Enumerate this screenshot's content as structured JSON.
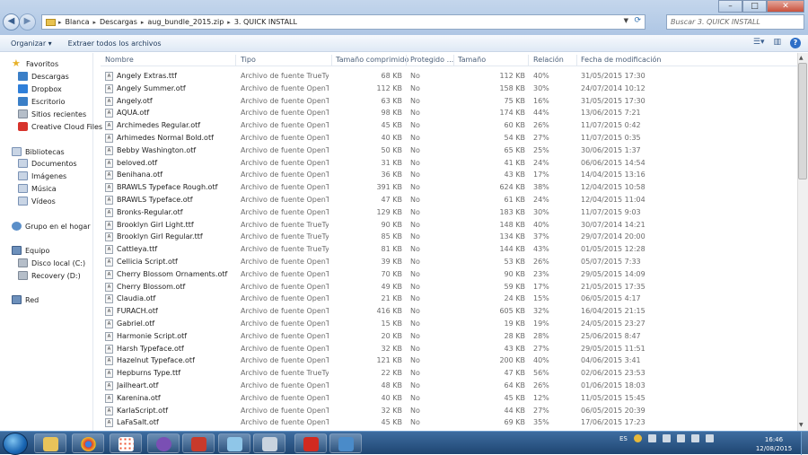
{
  "window": {
    "breadcrumbs": [
      "Blanca",
      "Descargas",
      "aug_bundle_2015.zip",
      "3. QUICK INSTALL"
    ],
    "search_placeholder": "Buscar 3. QUICK INSTALL",
    "minimize": "–",
    "maximize": "□",
    "close": "✕"
  },
  "toolbar": {
    "organize_label": "Organizar ▾",
    "extract_label": "Extraer todos los archivos",
    "help_label": "?"
  },
  "sidebar": {
    "favorites": {
      "label": "Favoritos",
      "items": [
        "Descargas",
        "Dropbox",
        "Escritorio",
        "Sitios recientes",
        "Creative Cloud Files"
      ]
    },
    "libraries": {
      "label": "Bibliotecas",
      "items": [
        "Documentos",
        "Imágenes",
        "Música",
        "Vídeos"
      ]
    },
    "homegroup": {
      "label": "Grupo en el hogar"
    },
    "computer": {
      "label": "Equipo",
      "items": [
        "Disco local (C:)",
        "Recovery (D:)"
      ]
    },
    "network": {
      "label": "Red"
    }
  },
  "columns": [
    "Nombre",
    "Tipo",
    "Tamaño comprimido",
    "Protegido ...",
    "Tamaño",
    "Relación",
    "Fecha de modificación"
  ],
  "files": [
    {
      "name": "Angely Extras.ttf",
      "type": "Archivo de fuente TrueTy...",
      "comp": "68 KB",
      "prot": "No",
      "size": "112 KB",
      "ratio": "40%",
      "date": "31/05/2015 17:30"
    },
    {
      "name": "Angely Summer.otf",
      "type": "Archivo de fuente OpenT...",
      "comp": "112 KB",
      "prot": "No",
      "size": "158 KB",
      "ratio": "30%",
      "date": "24/07/2014 10:12"
    },
    {
      "name": "Angely.otf",
      "type": "Archivo de fuente OpenT...",
      "comp": "63 KB",
      "prot": "No",
      "size": "75 KB",
      "ratio": "16%",
      "date": "31/05/2015 17:30"
    },
    {
      "name": "AQUA.otf",
      "type": "Archivo de fuente OpenT...",
      "comp": "98 KB",
      "prot": "No",
      "size": "174 KB",
      "ratio": "44%",
      "date": "13/06/2015 7:21"
    },
    {
      "name": "Archimedes Regular.otf",
      "type": "Archivo de fuente OpenT...",
      "comp": "45 KB",
      "prot": "No",
      "size": "60 KB",
      "ratio": "26%",
      "date": "11/07/2015 0:42"
    },
    {
      "name": "Arhimedes Normal Bold.otf",
      "type": "Archivo de fuente OpenT...",
      "comp": "40 KB",
      "prot": "No",
      "size": "54 KB",
      "ratio": "27%",
      "date": "11/07/2015 0:35"
    },
    {
      "name": "Bebby Washington.otf",
      "type": "Archivo de fuente OpenT...",
      "comp": "50 KB",
      "prot": "No",
      "size": "65 KB",
      "ratio": "25%",
      "date": "30/06/2015 1:37"
    },
    {
      "name": "beloved.otf",
      "type": "Archivo de fuente OpenT...",
      "comp": "31 KB",
      "prot": "No",
      "size": "41 KB",
      "ratio": "24%",
      "date": "06/06/2015 14:54"
    },
    {
      "name": "Benihana.otf",
      "type": "Archivo de fuente OpenT...",
      "comp": "36 KB",
      "prot": "No",
      "size": "43 KB",
      "ratio": "17%",
      "date": "14/04/2015 13:16"
    },
    {
      "name": "BRAWLS Typeface Rough.otf",
      "type": "Archivo de fuente OpenT...",
      "comp": "391 KB",
      "prot": "No",
      "size": "624 KB",
      "ratio": "38%",
      "date": "12/04/2015 10:58"
    },
    {
      "name": "BRAWLS Typeface.otf",
      "type": "Archivo de fuente OpenT...",
      "comp": "47 KB",
      "prot": "No",
      "size": "61 KB",
      "ratio": "24%",
      "date": "12/04/2015 11:04"
    },
    {
      "name": "Bronks-Regular.otf",
      "type": "Archivo de fuente OpenT...",
      "comp": "129 KB",
      "prot": "No",
      "size": "183 KB",
      "ratio": "30%",
      "date": "11/07/2015 9:03"
    },
    {
      "name": "Brooklyn Girl Light.ttf",
      "type": "Archivo de fuente TrueTy...",
      "comp": "90 KB",
      "prot": "No",
      "size": "148 KB",
      "ratio": "40%",
      "date": "30/07/2014 14:21"
    },
    {
      "name": "Brooklyn Girl Regular.ttf",
      "type": "Archivo de fuente TrueTy...",
      "comp": "85 KB",
      "prot": "No",
      "size": "134 KB",
      "ratio": "37%",
      "date": "29/07/2014 20:00"
    },
    {
      "name": "Cattleya.ttf",
      "type": "Archivo de fuente TrueTy...",
      "comp": "81 KB",
      "prot": "No",
      "size": "144 KB",
      "ratio": "43%",
      "date": "01/05/2015 12:28"
    },
    {
      "name": "Cellicia Script.otf",
      "type": "Archivo de fuente OpenT...",
      "comp": "39 KB",
      "prot": "No",
      "size": "53 KB",
      "ratio": "26%",
      "date": "05/07/2015 7:33"
    },
    {
      "name": "Cherry Blossom Ornaments.otf",
      "type": "Archivo de fuente OpenT...",
      "comp": "70 KB",
      "prot": "No",
      "size": "90 KB",
      "ratio": "23%",
      "date": "29/05/2015 14:09"
    },
    {
      "name": "Cherry Blossom.otf",
      "type": "Archivo de fuente OpenT...",
      "comp": "49 KB",
      "prot": "No",
      "size": "59 KB",
      "ratio": "17%",
      "date": "21/05/2015 17:35"
    },
    {
      "name": "Claudia.otf",
      "type": "Archivo de fuente OpenT...",
      "comp": "21 KB",
      "prot": "No",
      "size": "24 KB",
      "ratio": "15%",
      "date": "06/05/2015 4:17"
    },
    {
      "name": "FURACH.otf",
      "type": "Archivo de fuente OpenT...",
      "comp": "416 KB",
      "prot": "No",
      "size": "605 KB",
      "ratio": "32%",
      "date": "16/04/2015 21:15"
    },
    {
      "name": "Gabriel.otf",
      "type": "Archivo de fuente OpenT...",
      "comp": "15 KB",
      "prot": "No",
      "size": "19 KB",
      "ratio": "19%",
      "date": "24/05/2015 23:27"
    },
    {
      "name": "Harmonie Script.otf",
      "type": "Archivo de fuente OpenT...",
      "comp": "20 KB",
      "prot": "No",
      "size": "28 KB",
      "ratio": "28%",
      "date": "25/06/2015 8:47"
    },
    {
      "name": "Harsh Typeface.otf",
      "type": "Archivo de fuente OpenT...",
      "comp": "32 KB",
      "prot": "No",
      "size": "43 KB",
      "ratio": "27%",
      "date": "29/05/2015 11:51"
    },
    {
      "name": "Hazelnut Typeface.otf",
      "type": "Archivo de fuente OpenT...",
      "comp": "121 KB",
      "prot": "No",
      "size": "200 KB",
      "ratio": "40%",
      "date": "04/06/2015 3:41"
    },
    {
      "name": "Hepburns Type.ttf",
      "type": "Archivo de fuente TrueTy...",
      "comp": "22 KB",
      "prot": "No",
      "size": "47 KB",
      "ratio": "56%",
      "date": "02/06/2015 23:53"
    },
    {
      "name": "Jailheart.otf",
      "type": "Archivo de fuente OpenT...",
      "comp": "48 KB",
      "prot": "No",
      "size": "64 KB",
      "ratio": "26%",
      "date": "01/06/2015 18:03"
    },
    {
      "name": "Karenina.otf",
      "type": "Archivo de fuente OpenT...",
      "comp": "40 KB",
      "prot": "No",
      "size": "45 KB",
      "ratio": "12%",
      "date": "11/05/2015 15:45"
    },
    {
      "name": "KarlaScript.otf",
      "type": "Archivo de fuente OpenT...",
      "comp": "32 KB",
      "prot": "No",
      "size": "44 KB",
      "ratio": "27%",
      "date": "06/05/2015 20:39"
    },
    {
      "name": "LaFaSalt.otf",
      "type": "Archivo de fuente OpenT...",
      "comp": "45 KB",
      "prot": "No",
      "size": "69 KB",
      "ratio": "35%",
      "date": "17/06/2015 17:23"
    }
  ],
  "taskbar": {
    "lang": "ES",
    "time": "16:46",
    "date": "12/08/2015"
  }
}
